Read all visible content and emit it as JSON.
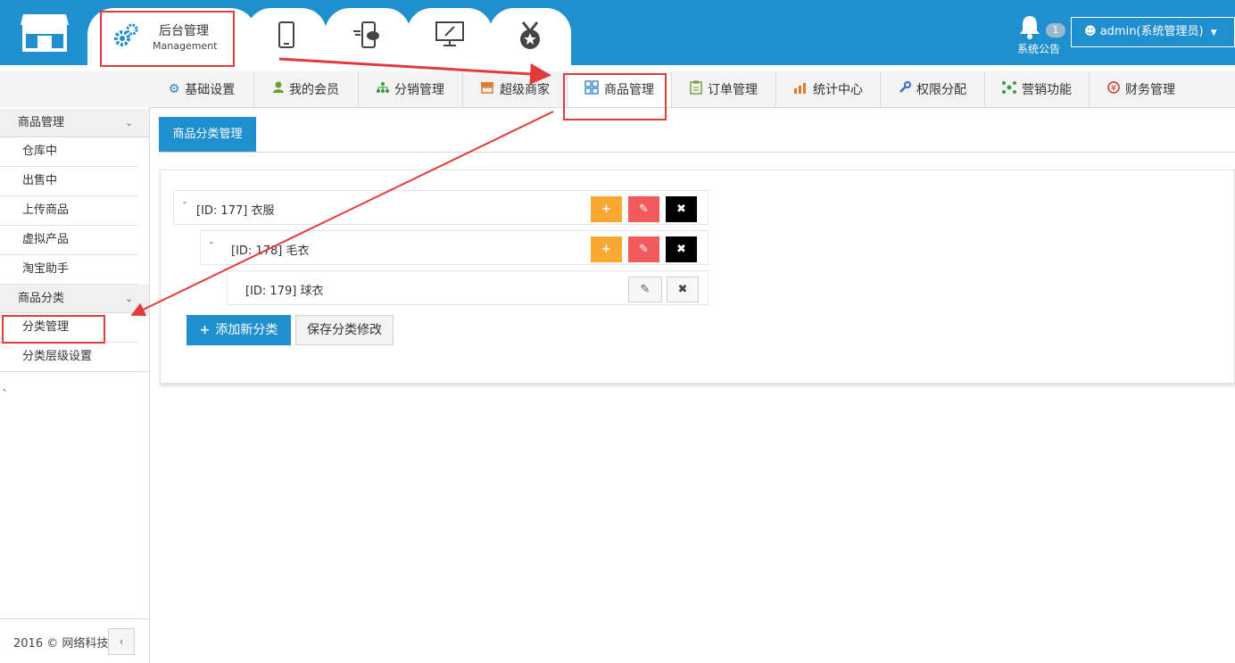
{
  "colors": {
    "brand": "#1f8fcf",
    "annotation": "#e23b3b",
    "add": "#f9a832",
    "edit": "#f05a5a",
    "delete": "#000000"
  },
  "header": {
    "main_tab": {
      "title": "后台管理",
      "subtitle": "Management",
      "icon": "gear-icon"
    },
    "icon_tabs": [
      "mobile-phone-icon",
      "mobile-chat-icon",
      "monitor-edit-icon",
      "medal-star-icon"
    ],
    "notice": {
      "badge": "1",
      "label": "系统公告"
    },
    "user": {
      "label": "admin(系统管理员)"
    }
  },
  "nav": {
    "items": [
      {
        "label": "基础设置",
        "icon": "gear-icon"
      },
      {
        "label": "我的会员",
        "icon": "member-icon"
      },
      {
        "label": "分销管理",
        "icon": "network-icon"
      },
      {
        "label": "超级商家",
        "icon": "shop-icon"
      },
      {
        "label": "商品管理",
        "icon": "grid-icon",
        "active": true
      },
      {
        "label": "订单管理",
        "icon": "clipboard-icon"
      },
      {
        "label": "统计中心",
        "icon": "chart-icon"
      },
      {
        "label": "权限分配",
        "icon": "wrench-icon"
      },
      {
        "label": "营销功能",
        "icon": "nodes-icon"
      },
      {
        "label": "财务管理",
        "icon": "money-icon"
      }
    ]
  },
  "sidebar": {
    "sections": [
      {
        "title": "商品管理",
        "items": [
          "仓库中",
          "出售中",
          "上传商品",
          "虚拟产品",
          "淘宝助手"
        ]
      },
      {
        "title": "商品分类",
        "items": [
          "分类管理",
          "分类层级设置"
        ]
      }
    ],
    "footer": "2016 © 网络科技",
    "collapse_label": "‹",
    "stray_mark": "、"
  },
  "main": {
    "subtab": "商品分类管理",
    "tree": [
      {
        "label": "[ID: 177] 衣服",
        "toggle": "-"
      },
      {
        "label": "[ID: 178] 毛衣",
        "toggle": "-"
      },
      {
        "label": "[ID: 179] 球衣"
      }
    ],
    "buttons": {
      "add_icon": "+",
      "edit_icon": "✎",
      "delete_icon": "✖",
      "add_category": "添加新分类",
      "add_category_icon": "+",
      "save_changes": "保存分类修改"
    }
  }
}
